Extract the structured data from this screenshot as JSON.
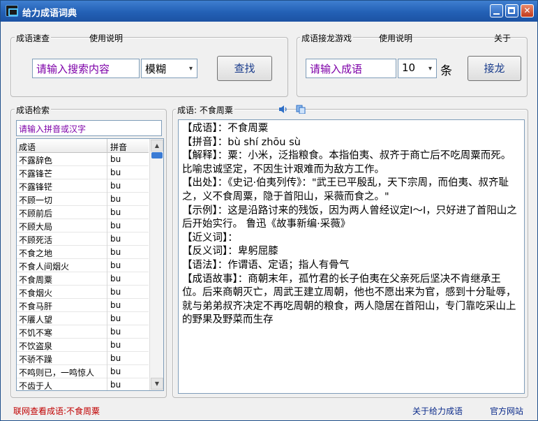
{
  "window": {
    "title": "给力成语词典"
  },
  "quick_search": {
    "group_label": "成语速查",
    "help_label": "使用说明",
    "search_placeholder": "请输入搜索内容",
    "mode_value": "模糊",
    "search_button": "查找"
  },
  "chain_game": {
    "group_label": "成语接龙游戏",
    "help_label": "使用说明",
    "about_label": "关于",
    "input_placeholder": "请输入成语",
    "count_value": "10",
    "count_unit": "条",
    "chain_button": "接龙"
  },
  "retrieval": {
    "group_label": "成语检索",
    "filter_placeholder": "请输入拼音或汉字",
    "columns": [
      "成语",
      "拼音"
    ],
    "rows": [
      [
        "不露辞色",
        "bu"
      ],
      [
        "不露锋芒",
        "bu"
      ],
      [
        "不露锋铓",
        "bu"
      ],
      [
        "不顾一切",
        "bu"
      ],
      [
        "不顾前后",
        "bu"
      ],
      [
        "不顾大局",
        "bu"
      ],
      [
        "不顾死活",
        "bu"
      ],
      [
        "不食之地",
        "bu"
      ],
      [
        "不食人间烟火",
        "bu"
      ],
      [
        "不食周粟",
        "bu"
      ],
      [
        "不食烟火",
        "bu"
      ],
      [
        "不食马肝",
        "bu"
      ],
      [
        "不餍人望",
        "bu"
      ],
      [
        "不饥不寒",
        "bu"
      ],
      [
        "不饮盗泉",
        "bu"
      ],
      [
        "不骄不躁",
        "bu"
      ],
      [
        "不鸣则已，一鸣惊人",
        "bu"
      ],
      [
        "不齿于人",
        "bu"
      ]
    ]
  },
  "detail": {
    "group_label": "成语: 不食周粟",
    "speaker_icon": "speaker-icon",
    "copy_icon": "copy-icon",
    "lines": [
      "【成语】：不食周粟",
      "【拼音】：bù shí zhōu sù",
      "【解释】：粟：小米，泛指粮食。本指伯夷、叔齐于商亡后不吃周粟而死。比喻忠诚坚定，不因生计艰难而为敌方工作。",
      "【出处】：《史记·伯夷列传》：\"武王已平殷乱，天下宗周，而伯夷、叔齐耻之，义不食周粟，隐于首阳山，采薇而食之。\"",
      "【示例】：这是沿路讨来的残饭，因为两人曾经议定I～I，只好进了首阳山之后开始实行。 鲁迅《故事新编·采薇》",
      "【近义词】：",
      "【反义词】：卑躬屈膝",
      "【语法】：作谓语、定语；指人有骨气",
      "【成语故事】：商朝末年，孤竹君的长子伯夷在父亲死后坚决不肯继承王位。后来商朝灭亡，周武王建立周朝，他也不愿出来为官，感到十分耻辱，就与弟弟叔齐决定不再吃周朝的粮食，两人隐居在首阳山，专门靠吃采山上的野果及野菜而生存"
    ]
  },
  "footer": {
    "online_lookup": "联网查看成语:不食周粟",
    "about_link": "关于给力成语",
    "website_link": "官方网站"
  },
  "colors": {
    "title_bar": "#2360b5",
    "input_text": "#7d00a8",
    "footer_red": "#c00000"
  }
}
